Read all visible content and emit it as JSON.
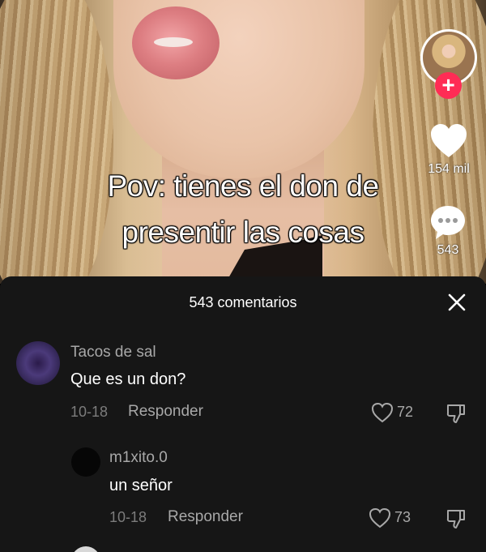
{
  "video": {
    "caption_line1": "Pov: tienes el don de",
    "caption_line2": "presentir las cosas",
    "like_count": "154 mil",
    "comment_count": "543"
  },
  "comments_panel": {
    "title": "543 comentarios",
    "comments": [
      {
        "user": "Tacos de sal",
        "text": "Que es un don?",
        "date": "10-18",
        "reply_label": "Responder",
        "likes": "72"
      },
      {
        "user": "m1xito.0",
        "text": "un señor",
        "date": "10-18",
        "reply_label": "Responder",
        "likes": "73"
      }
    ]
  },
  "colors": {
    "follow": "#ff2c55",
    "panel": "#161616"
  },
  "icons": [
    "plus-icon",
    "heart-icon",
    "comment-bubble-icon",
    "close-icon",
    "like-heart-icon",
    "dislike-icon"
  ]
}
